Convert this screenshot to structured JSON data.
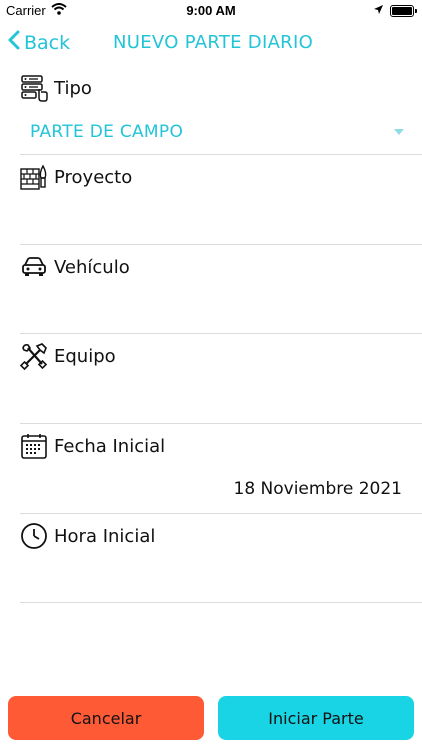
{
  "status_bar": {
    "carrier": "Carrier",
    "time": "9:00 AM"
  },
  "nav": {
    "back_label": "Back",
    "title": "NUEVO PARTE DIARIO"
  },
  "form": {
    "tipo": {
      "label": "Tipo",
      "selected": "PARTE DE CAMPO"
    },
    "proyecto": {
      "label": "Proyecto",
      "value": ""
    },
    "vehiculo": {
      "label": "Vehículo",
      "value": ""
    },
    "equipo": {
      "label": "Equipo",
      "value": ""
    },
    "fecha_inicial": {
      "label": "Fecha Inicial",
      "value": "18 Noviembre 2021"
    },
    "hora_inicial": {
      "label": "Hora Inicial",
      "value": ""
    }
  },
  "buttons": {
    "cancel": "Cancelar",
    "start": "Iniciar Parte"
  },
  "colors": {
    "accent": "#22c4d8",
    "cancel": "#ff5a36",
    "start": "#19d4e4"
  }
}
